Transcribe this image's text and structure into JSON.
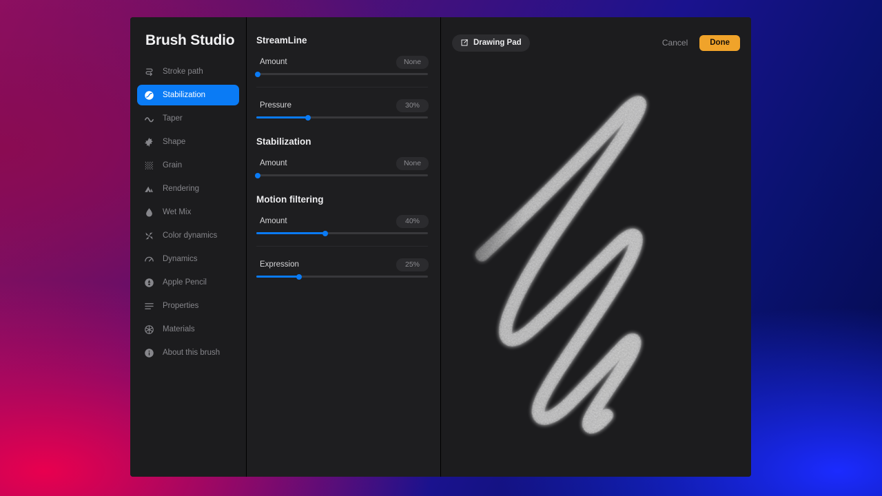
{
  "app": {
    "title": "Brush Studio"
  },
  "sidebar": {
    "items": [
      {
        "label": "Stroke path",
        "icon": "stroke-path-icon",
        "active": false
      },
      {
        "label": "Stabilization",
        "icon": "stabilization-icon",
        "active": true
      },
      {
        "label": "Taper",
        "icon": "taper-icon",
        "active": false
      },
      {
        "label": "Shape",
        "icon": "shape-icon",
        "active": false
      },
      {
        "label": "Grain",
        "icon": "grain-icon",
        "active": false
      },
      {
        "label": "Rendering",
        "icon": "rendering-icon",
        "active": false
      },
      {
        "label": "Wet Mix",
        "icon": "wet-mix-icon",
        "active": false
      },
      {
        "label": "Color dynamics",
        "icon": "color-dynamics-icon",
        "active": false
      },
      {
        "label": "Dynamics",
        "icon": "dynamics-icon",
        "active": false
      },
      {
        "label": "Apple Pencil",
        "icon": "apple-pencil-icon",
        "active": false
      },
      {
        "label": "Properties",
        "icon": "properties-icon",
        "active": false
      },
      {
        "label": "Materials",
        "icon": "materials-icon",
        "active": false
      },
      {
        "label": "About this brush",
        "icon": "info-icon",
        "active": false
      }
    ]
  },
  "settings": {
    "groups": [
      {
        "title": "StreamLine",
        "sliders": [
          {
            "label": "Amount",
            "value": "None",
            "percent": 1,
            "divider": true
          },
          {
            "label": "Pressure",
            "value": "30%",
            "percent": 30,
            "divider": false
          }
        ]
      },
      {
        "title": "Stabilization",
        "sliders": [
          {
            "label": "Amount",
            "value": "None",
            "percent": 1,
            "divider": false
          }
        ]
      },
      {
        "title": "Motion filtering",
        "sliders": [
          {
            "label": "Amount",
            "value": "40%",
            "percent": 40,
            "divider": true
          },
          {
            "label": "Expression",
            "value": "25%",
            "percent": 25,
            "divider": false
          }
        ]
      }
    ]
  },
  "topbar": {
    "drawing_pad_label": "Drawing Pad",
    "drawing_pad_icon": "edit-square-icon",
    "cancel_label": "Cancel",
    "done_label": "Done",
    "drag_handle_icon": "drag-dots-icon"
  },
  "colors": {
    "accent_blue": "#0a7bf5",
    "done_orange": "#f0a32a",
    "panel_bg": "#1c1c1e",
    "settings_bg": "#1e1e20",
    "pill_bg": "#2b2b2e",
    "track": "#38383b",
    "label_muted": "#86868b"
  },
  "canvas": {
    "stroke_description": "grainy-zigzag-brush-stroke",
    "stroke_color": "#d8d8d8"
  }
}
